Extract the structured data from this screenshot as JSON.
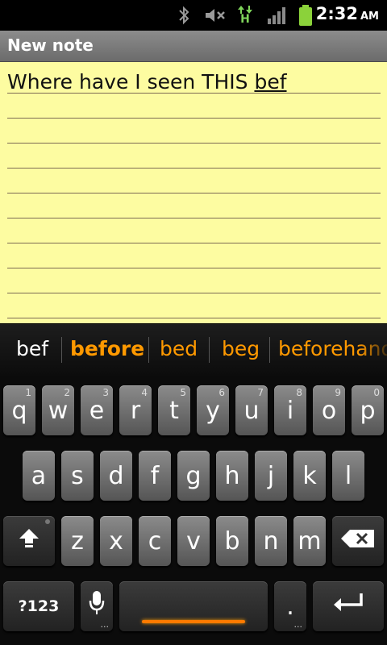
{
  "status_bar": {
    "icons": [
      "bluetooth-icon",
      "mute-icon",
      "hspa-data-icon",
      "signal-icon",
      "battery-icon"
    ],
    "hspa_label": "H",
    "time": "2:32",
    "ampm": "AM"
  },
  "title_bar": {
    "title": "New note"
  },
  "note": {
    "text_before": "Where have I seen THIS ",
    "composing": "bef"
  },
  "suggestions": [
    {
      "text": "bef",
      "color": "#ffffff",
      "bold": false
    },
    {
      "text": "before",
      "color": "#ff9900",
      "bold": true
    },
    {
      "text": "bed",
      "color": "#ff9900",
      "bold": false
    },
    {
      "text": "beg",
      "color": "#ff9900",
      "bold": false
    },
    {
      "text": "beforehand",
      "color": "#ff9900",
      "bold": false
    }
  ],
  "keyboard": {
    "row1": [
      {
        "label": "q",
        "hint": "1"
      },
      {
        "label": "w",
        "hint": "2"
      },
      {
        "label": "e",
        "hint": "3"
      },
      {
        "label": "r",
        "hint": "4"
      },
      {
        "label": "t",
        "hint": "5"
      },
      {
        "label": "y",
        "hint": "6"
      },
      {
        "label": "u",
        "hint": "7"
      },
      {
        "label": "i",
        "hint": "8"
      },
      {
        "label": "o",
        "hint": "9"
      },
      {
        "label": "p",
        "hint": "0"
      }
    ],
    "row2": [
      {
        "label": "a"
      },
      {
        "label": "s"
      },
      {
        "label": "d"
      },
      {
        "label": "f"
      },
      {
        "label": "g"
      },
      {
        "label": "h"
      },
      {
        "label": "j"
      },
      {
        "label": "k"
      },
      {
        "label": "l"
      }
    ],
    "row3": [
      {
        "label": "z"
      },
      {
        "label": "x"
      },
      {
        "label": "c"
      },
      {
        "label": "v"
      },
      {
        "label": "b"
      },
      {
        "label": "n"
      },
      {
        "label": "m"
      }
    ],
    "symbols_label": "?123",
    "period_label": ".",
    "hint_dots": "..."
  },
  "colors": {
    "accent": "#ff9900",
    "note_bg": "#fdfca1",
    "hspa": "#7fd45a"
  }
}
